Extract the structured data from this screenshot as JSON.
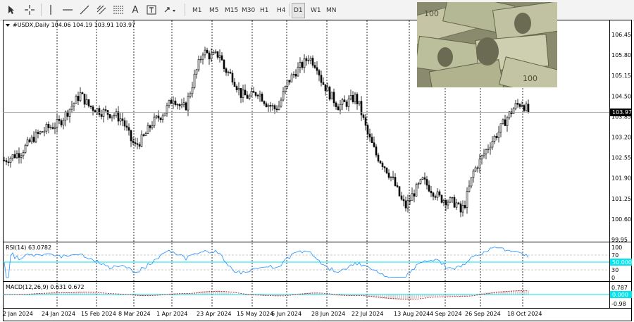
{
  "toolbar": {
    "timeframes": [
      "M1",
      "M5",
      "M15",
      "M30",
      "H1",
      "H4",
      "D1",
      "W1",
      "MN"
    ],
    "active_timeframe": "D1"
  },
  "main": {
    "header": "#USDX,Daily  104.06 104.19 103.91 103.97",
    "current_price": "103.97",
    "price_ticks": [
      "106.45",
      "105.80",
      "105.15",
      "104.50",
      "103.85",
      "103.20",
      "102.55",
      "101.90",
      "101.25",
      "100.60",
      "99.95"
    ]
  },
  "rsi": {
    "label": "RSI(14) 63.0782",
    "value_box": "50.0000",
    "ticks": [
      "100",
      "70",
      "30",
      "0"
    ]
  },
  "macd": {
    "label": "MACD(12,26,9) 0.631 0.672",
    "value_box": "0.000",
    "ticks": [
      "0.787",
      "-0.98"
    ]
  },
  "dates": [
    "2 Jan 2024",
    "24 Jan 2024",
    "15 Feb 2024",
    "8 Mar 2024",
    "1 Apr 2024",
    "23 Apr 2024",
    "15 May 2024",
    "6 Jun 2024",
    "28 Jun 2024",
    "22 Jul 2024",
    "13 Aug 2024",
    "4 Sep 2024",
    "26 Sep 2024",
    "18 Oct 2024"
  ],
  "colors": {
    "grid_dash": "#000000",
    "rsi_line": "#1e90ff",
    "cyan": "#00e5ee",
    "macd_signal": "#c00000"
  },
  "chart_data": {
    "type": "candlestick",
    "symbol": "#USDX",
    "timeframe": "Daily",
    "ylim": [
      99.6,
      106.8
    ],
    "waypoints": [
      {
        "x": 0,
        "y": 102.3
      },
      {
        "x": 8,
        "y": 102.6
      },
      {
        "x": 14,
        "y": 103.1
      },
      {
        "x": 20,
        "y": 103.4
      },
      {
        "x": 26,
        "y": 103.6
      },
      {
        "x": 32,
        "y": 104.2
      },
      {
        "x": 36,
        "y": 104.6
      },
      {
        "x": 40,
        "y": 104.2
      },
      {
        "x": 46,
        "y": 104.0
      },
      {
        "x": 52,
        "y": 103.9
      },
      {
        "x": 56,
        "y": 103.7
      },
      {
        "x": 60,
        "y": 103.0
      },
      {
        "x": 62,
        "y": 102.8
      },
      {
        "x": 66,
        "y": 103.1
      },
      {
        "x": 70,
        "y": 103.6
      },
      {
        "x": 76,
        "y": 104.0
      },
      {
        "x": 80,
        "y": 104.5
      },
      {
        "x": 84,
        "y": 104.1
      },
      {
        "x": 86,
        "y": 104.2
      },
      {
        "x": 90,
        "y": 105.2
      },
      {
        "x": 94,
        "y": 106.1
      },
      {
        "x": 98,
        "y": 105.9
      },
      {
        "x": 102,
        "y": 106.0
      },
      {
        "x": 104,
        "y": 105.5
      },
      {
        "x": 108,
        "y": 105.2
      },
      {
        "x": 112,
        "y": 104.6
      },
      {
        "x": 116,
        "y": 104.5
      },
      {
        "x": 120,
        "y": 104.7
      },
      {
        "x": 124,
        "y": 104.3
      },
      {
        "x": 128,
        "y": 104.1
      },
      {
        "x": 130,
        "y": 104.2
      },
      {
        "x": 134,
        "y": 105.0
      },
      {
        "x": 138,
        "y": 105.4
      },
      {
        "x": 142,
        "y": 105.7
      },
      {
        "x": 144,
        "y": 105.9
      },
      {
        "x": 148,
        "y": 105.6
      },
      {
        "x": 150,
        "y": 105.1
      },
      {
        "x": 154,
        "y": 104.6
      },
      {
        "x": 158,
        "y": 104.2
      },
      {
        "x": 162,
        "y": 104.3
      },
      {
        "x": 166,
        "y": 104.5
      },
      {
        "x": 168,
        "y": 104.2
      },
      {
        "x": 172,
        "y": 103.2
      },
      {
        "x": 176,
        "y": 102.5
      },
      {
        "x": 180,
        "y": 102.1
      },
      {
        "x": 184,
        "y": 101.6
      },
      {
        "x": 188,
        "y": 100.9
      },
      {
        "x": 190,
        "y": 100.7
      },
      {
        "x": 194,
        "y": 101.2
      },
      {
        "x": 198,
        "y": 101.6
      },
      {
        "x": 202,
        "y": 101.3
      },
      {
        "x": 206,
        "y": 101.0
      },
      {
        "x": 210,
        "y": 100.9
      },
      {
        "x": 214,
        "y": 100.8
      },
      {
        "x": 216,
        "y": 100.5
      },
      {
        "x": 218,
        "y": 100.8
      },
      {
        "x": 222,
        "y": 101.9
      },
      {
        "x": 226,
        "y": 102.4
      },
      {
        "x": 230,
        "y": 102.9
      },
      {
        "x": 234,
        "y": 103.3
      },
      {
        "x": 238,
        "y": 103.8
      },
      {
        "x": 242,
        "y": 104.2
      },
      {
        "x": 245,
        "y": 104.3
      },
      {
        "x": 248,
        "y": 104.0
      }
    ]
  }
}
